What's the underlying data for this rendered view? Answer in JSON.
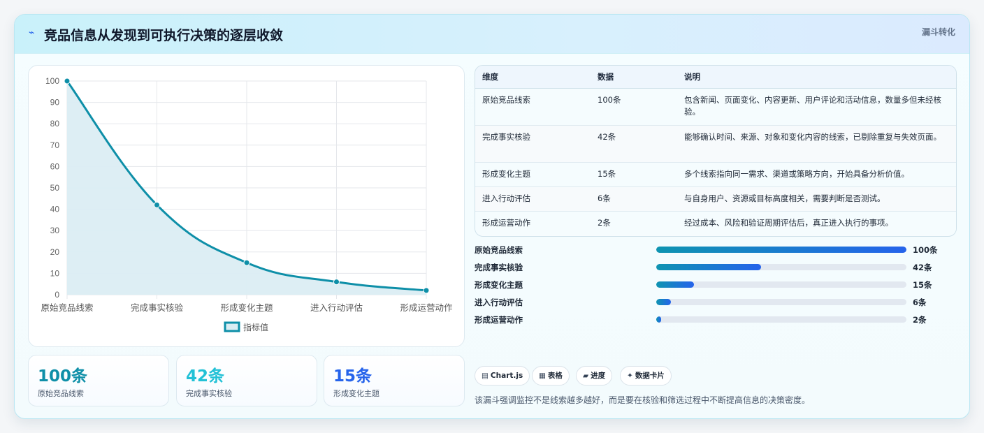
{
  "header": {
    "icon": "line-chart-icon",
    "title": "竞品信息从发现到可执行决策的逐层收敛",
    "badge": "漏斗转化"
  },
  "chart_data": {
    "type": "area",
    "categories": [
      "原始竞品线索",
      "完成事实核验",
      "形成变化主题",
      "进入行动评估",
      "形成运营动作"
    ],
    "series": [
      {
        "name": "指标值",
        "values": [
          100,
          42,
          15,
          6,
          2
        ]
      }
    ],
    "ylim": [
      0,
      100
    ],
    "yticks": [
      0,
      10,
      20,
      30,
      40,
      50,
      60,
      70,
      80,
      90,
      100
    ],
    "grid": true,
    "legend": "bottom",
    "colors": {
      "line": "#0e8fa8",
      "fill": "#dbedf3",
      "grid": "#e5e7eb"
    }
  },
  "stats": [
    {
      "value": "100条",
      "label": "原始竞品线索",
      "color": "#0e8fa8"
    },
    {
      "value": "42条",
      "label": "完成事实核验",
      "color": "#22c1d6"
    },
    {
      "value": "15条",
      "label": "形成变化主题",
      "color": "#2563eb"
    }
  ],
  "table": {
    "headers": [
      "维度",
      "数据",
      "说明"
    ],
    "rows": [
      [
        "原始竞品线索",
        "100条",
        "包含新闻、页面变化、内容更新、用户评论和活动信息，数量多但未经核验。"
      ],
      [
        "完成事实核验",
        "42条",
        "能够确认时间、来源、对象和变化内容的线索，已剔除重复与失效页面。"
      ],
      [
        "形成变化主题",
        "15条",
        "多个线索指向同一需求、渠道或策略方向，开始具备分析价值。"
      ],
      [
        "进入行动评估",
        "6条",
        "与自身用户、资源或目标高度相关，需要判断是否测试。"
      ],
      [
        "形成运营动作",
        "2条",
        "经过成本、风险和验证周期评估后，真正进入执行的事项。"
      ]
    ]
  },
  "progress": [
    {
      "label": "原始竞品线索",
      "value": "100条",
      "fraction": 1.0
    },
    {
      "label": "完成事实核验",
      "value": "42条",
      "fraction": 0.42
    },
    {
      "label": "形成变化主题",
      "value": "15条",
      "fraction": 0.15
    },
    {
      "label": "进入行动评估",
      "value": "6条",
      "fraction": 0.06
    },
    {
      "label": "形成运营动作",
      "value": "2条",
      "fraction": 0.02
    }
  ],
  "tags": [
    {
      "icon": "▤",
      "label": "Chart.js"
    },
    {
      "icon": "▦",
      "label": "表格"
    },
    {
      "icon": "▰",
      "label": "进度"
    },
    {
      "icon": "✦",
      "label": "数据卡片"
    }
  ],
  "note": "该漏斗强调监控不是线索越多越好，而是要在核验和筛选过程中不断提高信息的决策密度。"
}
